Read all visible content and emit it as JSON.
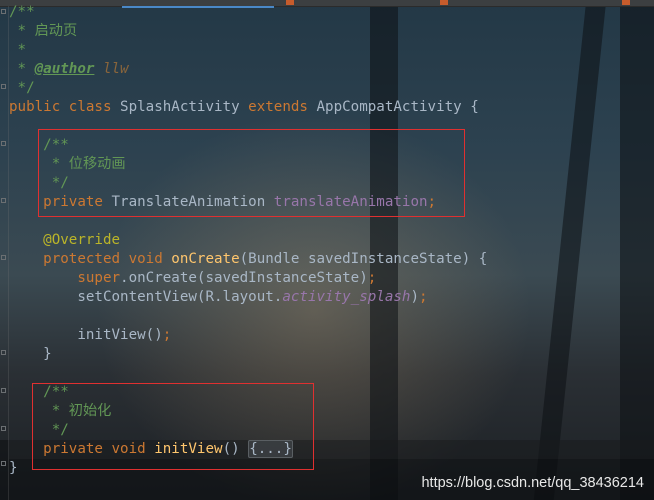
{
  "editor": {
    "lines": [
      [
        {
          "t": "/**",
          "s": "c-doc"
        }
      ],
      [
        {
          "t": " * 启动页",
          "s": "c-doc"
        }
      ],
      [
        {
          "t": " *",
          "s": "c-doc"
        }
      ],
      [
        {
          "t": " * ",
          "s": "c-doc"
        },
        {
          "t": "@author",
          "s": "c-tag"
        },
        {
          "t": " llw",
          "s": "c-tagval"
        }
      ],
      [
        {
          "t": " */",
          "s": "c-doc"
        }
      ],
      [
        {
          "t": "public class ",
          "s": "c-kw"
        },
        {
          "t": "SplashActivity ",
          "s": ""
        },
        {
          "t": "extends ",
          "s": "c-kw"
        },
        {
          "t": "AppCompatActivity {",
          "s": ""
        }
      ],
      [],
      [
        {
          "t": "    /**",
          "s": "c-doc"
        }
      ],
      [
        {
          "t": "     * 位移动画",
          "s": "c-doc"
        }
      ],
      [
        {
          "t": "     */",
          "s": "c-doc"
        }
      ],
      [
        {
          "t": "    private ",
          "s": "c-kw"
        },
        {
          "t": "TranslateAnimation ",
          "s": ""
        },
        {
          "t": "translateAnimation",
          "s": "c-field"
        },
        {
          "t": ";",
          "s": "c-kw"
        }
      ],
      [],
      [
        {
          "t": "    @Override",
          "s": "c-ann"
        }
      ],
      [
        {
          "t": "    protected void ",
          "s": "c-kw"
        },
        {
          "t": "onCreate",
          "s": "c-fn"
        },
        {
          "t": "(Bundle savedInstanceState) {",
          "s": ""
        }
      ],
      [
        {
          "t": "        super",
          "s": "c-kw"
        },
        {
          "t": ".onCreate(savedInstanceState)",
          "s": ""
        },
        {
          "t": ";",
          "s": "c-kw"
        }
      ],
      [
        {
          "t": "        setContentView(R.layout.",
          "s": ""
        },
        {
          "t": "activity_splash",
          "s": "c-italic"
        },
        {
          "t": ")",
          "s": ""
        },
        {
          "t": ";",
          "s": "c-kw"
        }
      ],
      [],
      [
        {
          "t": "        initView()",
          "s": ""
        },
        {
          "t": ";",
          "s": "c-kw"
        }
      ],
      [
        {
          "t": "    }",
          "s": ""
        }
      ],
      [],
      [
        {
          "t": "    /**",
          "s": "c-doc"
        }
      ],
      [
        {
          "t": "     * 初始化",
          "s": "c-doc"
        }
      ],
      [
        {
          "t": "     */",
          "s": "c-doc"
        }
      ],
      [
        {
          "t": "    private void ",
          "s": "c-kw"
        },
        {
          "t": "initView",
          "s": "c-fn"
        },
        {
          "t": "() ",
          "s": ""
        },
        {
          "t": "{...}",
          "s": "c-fold"
        }
      ],
      [
        {
          "t": "}",
          "s": ""
        }
      ]
    ]
  },
  "watermark": "https://blog.csdn.net/qq_38436214"
}
